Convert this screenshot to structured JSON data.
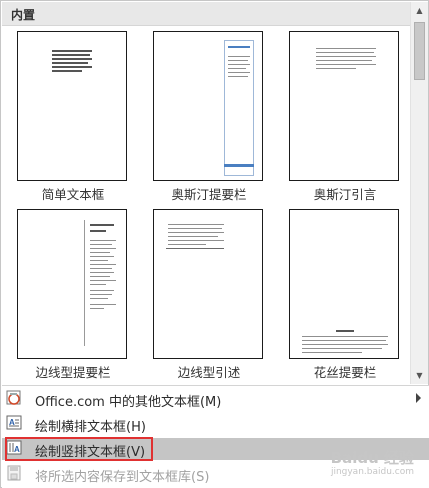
{
  "gallery": {
    "header": "内置",
    "tiles": [
      {
        "label": "简单文本框"
      },
      {
        "label": "奥斯汀提要栏"
      },
      {
        "label": "奥斯汀引言"
      },
      {
        "label": "边线型提要栏"
      },
      {
        "label": "边线型引述"
      },
      {
        "label": "花丝提要栏"
      }
    ]
  },
  "menu": {
    "items": [
      {
        "label": "Office.com 中的其他文本框(M)",
        "icon": "office-globe-icon"
      },
      {
        "label": "绘制横排文本框(H)",
        "icon": "horizontal-textbox-icon"
      },
      {
        "label": "绘制竖排文本框(V)",
        "icon": "vertical-textbox-icon"
      },
      {
        "label": "将所选内容保存到文本框库(S)",
        "icon": "save-selection-icon"
      }
    ]
  },
  "watermark": {
    "text": "Baidu 经验",
    "url": "jingyan.baidu.com"
  },
  "colors": {
    "highlight": "#e03131",
    "accent": "#4a7fc1"
  }
}
